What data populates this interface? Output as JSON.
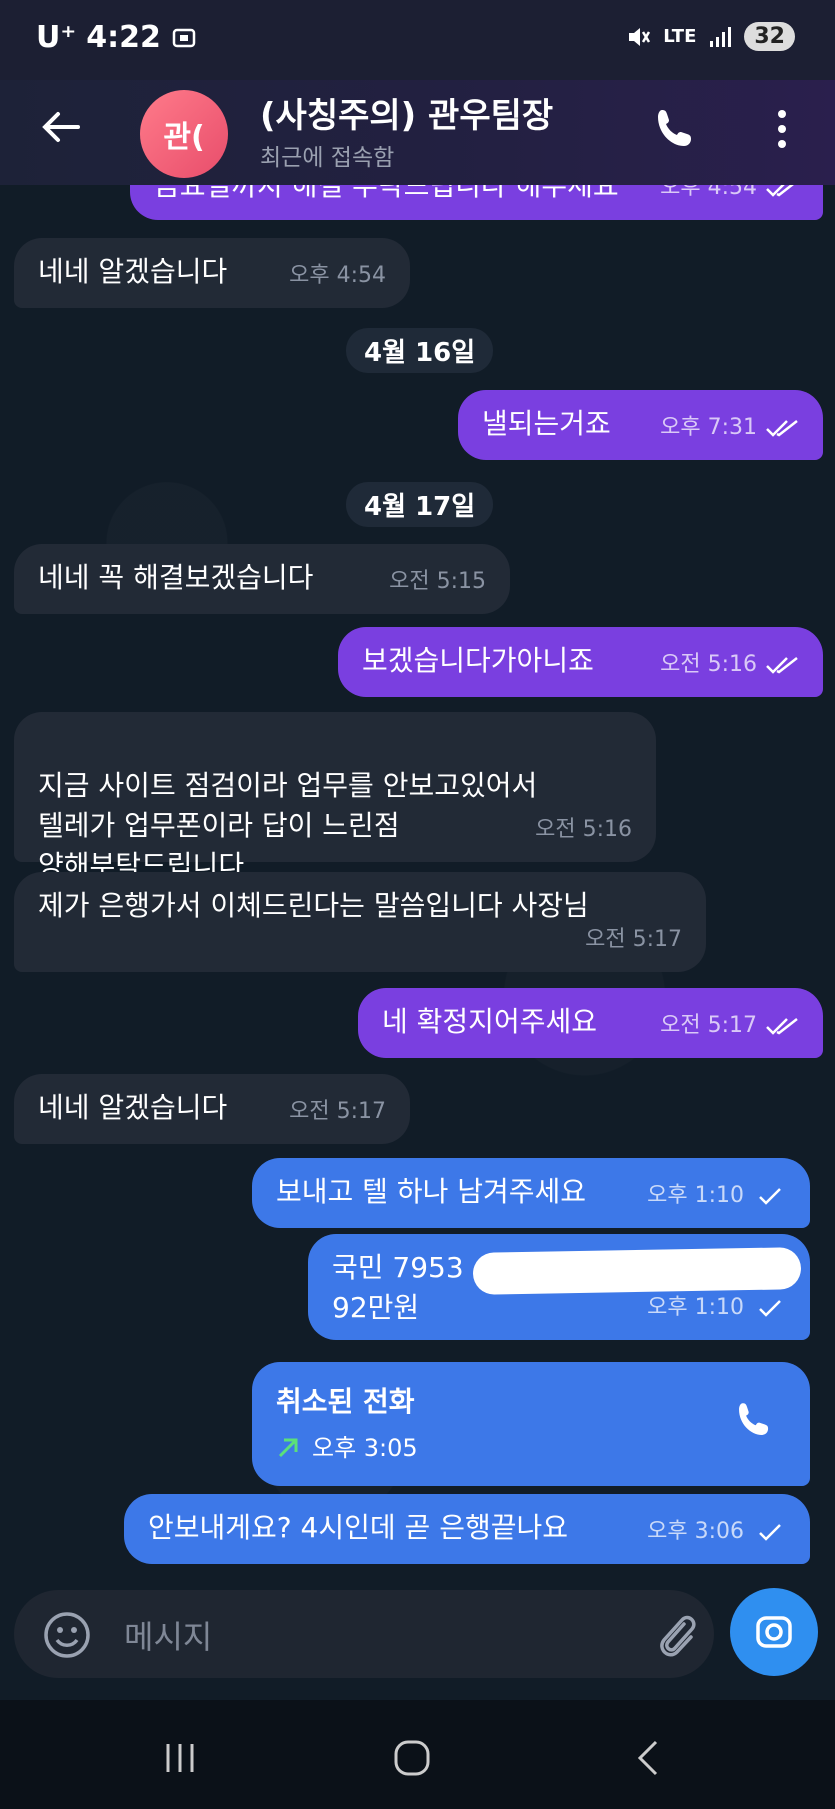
{
  "status_bar": {
    "carrier": "U⁺",
    "time": "4:22",
    "network": "LTE",
    "battery": "32"
  },
  "header": {
    "avatar_text": "관(",
    "name": "(사칭주의) 관우팀장",
    "status": "최근에 접속함"
  },
  "messages": [
    {
      "text": "금요일까지 해결 부탁드립니다 해주세요",
      "time": "오후 4:54",
      "dir": "out"
    },
    {
      "text": "네네 알겠습니다",
      "time": "오후 4:54",
      "dir": "in"
    },
    {
      "date": "4월 16일"
    },
    {
      "text": "낼되는거죠",
      "time": "오후 7:31",
      "dir": "out"
    },
    {
      "date": "4월 17일"
    },
    {
      "text": "네네 꼭 해결보겠습니다",
      "time": "오전 5:15",
      "dir": "in"
    },
    {
      "text": "보겠습니다가아니죠",
      "time": "오전 5:16",
      "dir": "out"
    },
    {
      "text": "지금 사이트 점검이라 업무를 안보고있어서\n텔레가 업무폰이라 답이 느린점\n양해부탁드립니다",
      "time": "오전 5:16",
      "dir": "in"
    },
    {
      "text": "제가 은행가서 이체드린다는 말씀입니다 사장님",
      "time": "오전 5:17",
      "dir": "in"
    },
    {
      "text": "네 확정지어주세요",
      "time": "오전 5:17",
      "dir": "out"
    },
    {
      "text": "네네 알겠습니다",
      "time": "오전 5:17",
      "dir": "in"
    },
    {
      "text": "보내고 텔 하나 남겨주세요",
      "time": "오후 1:10",
      "dir": "out"
    },
    {
      "text_line1": "국민 7953",
      "text_line2": "92만원",
      "time": "오후 1:10",
      "dir": "out"
    },
    {
      "call_title": "취소된 전화",
      "time": "오후 3:05",
      "dir": "out"
    },
    {
      "text": "안보내게요? 4시인데 곧 은행끝나요",
      "time": "오후 3:06",
      "dir": "out"
    }
  ],
  "composer": {
    "placeholder": "메시지"
  },
  "colors": {
    "outgoing_purple": "#7a3fe0",
    "outgoing_blue": "#3d78e8",
    "incoming": "#222a36",
    "accent": "#2f8ff0"
  }
}
